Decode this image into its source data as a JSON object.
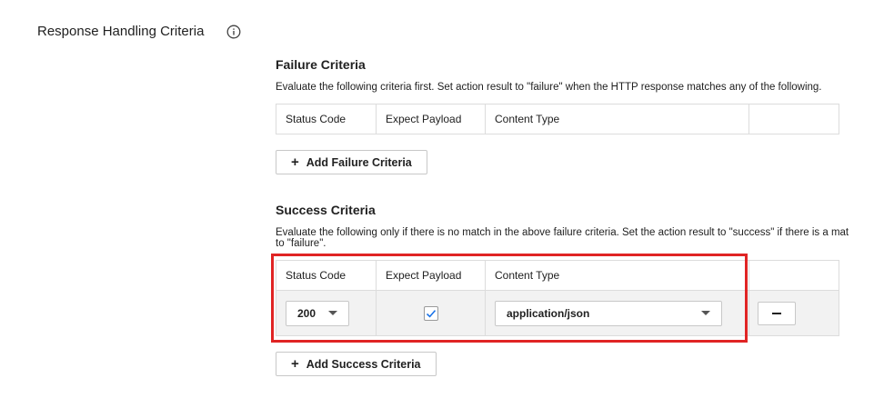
{
  "section": {
    "label": "Response Handling Criteria",
    "info_icon": "info-circle-icon"
  },
  "failure": {
    "title": "Failure Criteria",
    "description": "Evaluate the following criteria first. Set action result to \"failure\" when the HTTP response matches any of the following.",
    "columns": [
      "Status Code",
      "Expect Payload",
      "Content Type",
      ""
    ],
    "add_button_label": "Add Failure Criteria"
  },
  "success": {
    "title": "Success Criteria",
    "description": "Evaluate the following only if there is no match in the above failure criteria. Set the action result to \"success\" if there is a mat\nto \"failure\".",
    "columns": [
      "Status Code",
      "Expect Payload",
      "Content Type",
      ""
    ],
    "rows": [
      {
        "status_code": "200",
        "expect_payload": true,
        "content_type": "application/json",
        "remove_icon": "minus-icon"
      }
    ],
    "add_button_label": "Add Success Criteria"
  },
  "colors": {
    "highlight": "#e02424",
    "checkmark": "#1a73e8",
    "row_background": "#f2f2f2",
    "border": "#dcdcdc"
  }
}
